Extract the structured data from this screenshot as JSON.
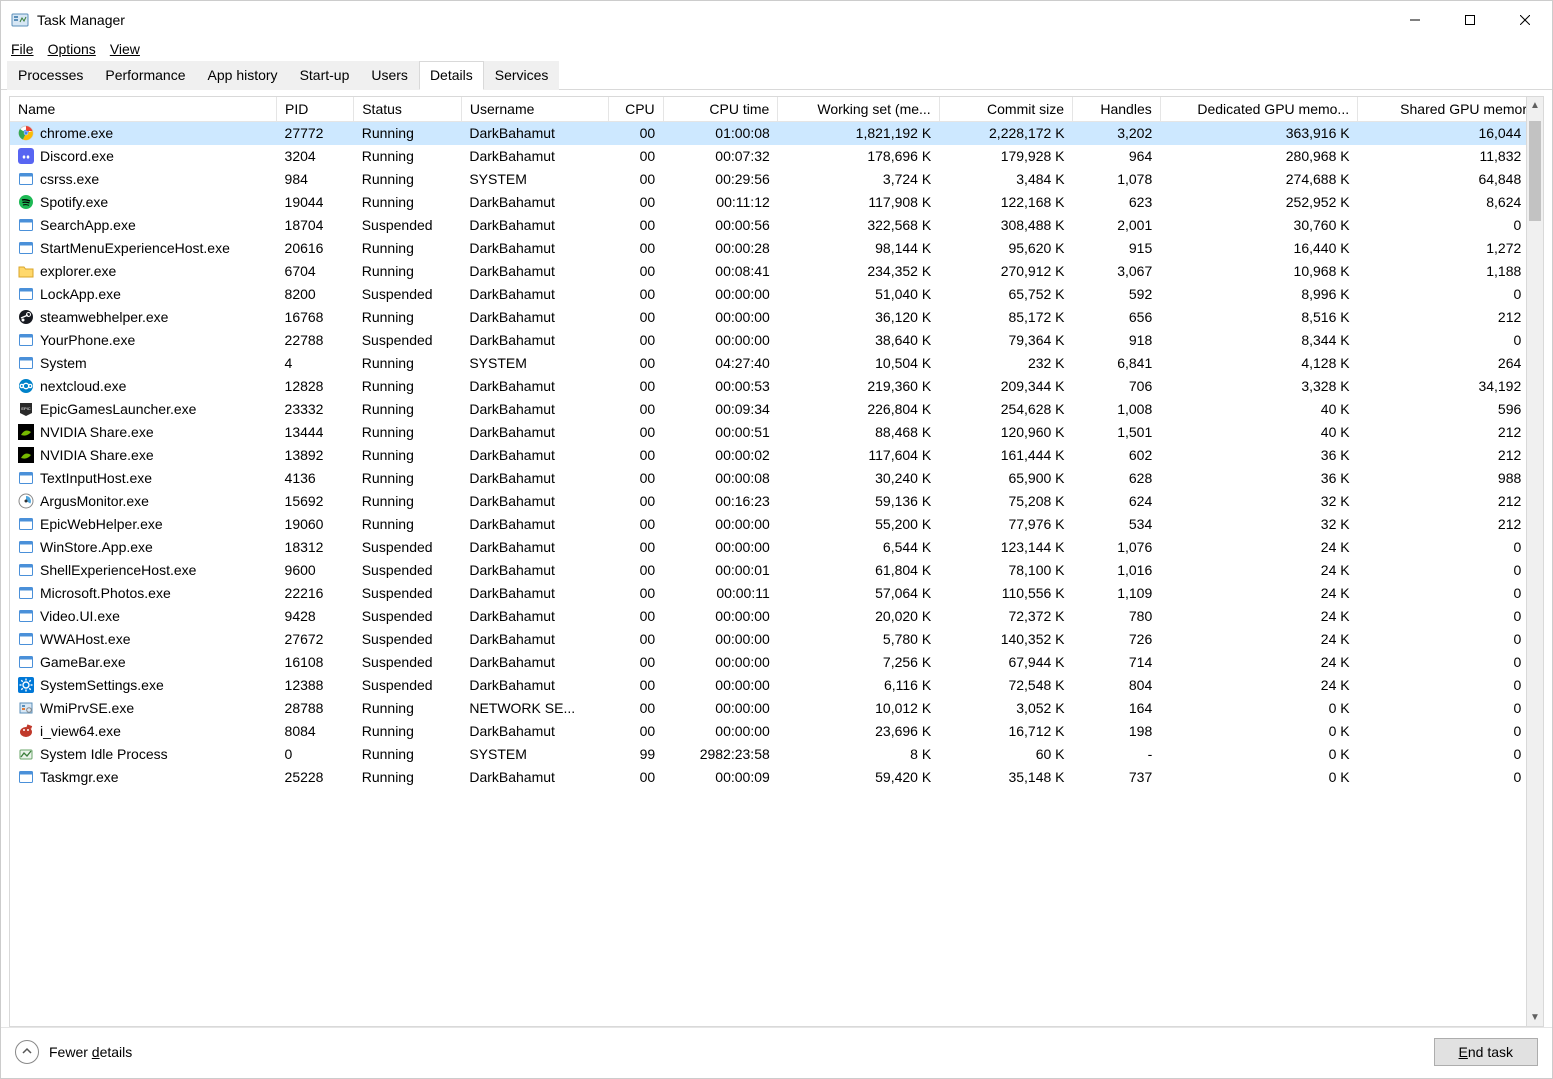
{
  "window": {
    "title": "Task Manager",
    "min_tooltip": "Minimize",
    "max_tooltip": "Maximize",
    "close_tooltip": "Close"
  },
  "menubar": {
    "file": "File",
    "options": "Options",
    "view": "View"
  },
  "tabs": [
    {
      "label": "Processes"
    },
    {
      "label": "Performance"
    },
    {
      "label": "App history"
    },
    {
      "label": "Start-up"
    },
    {
      "label": "Users"
    },
    {
      "label": "Details",
      "active": true
    },
    {
      "label": "Services"
    }
  ],
  "columns": {
    "name": "Name",
    "pid": "PID",
    "status": "Status",
    "username": "Username",
    "cpu": "CPU",
    "cputime": "CPU time",
    "workingset": "Working set (me...",
    "commit": "Commit size",
    "handles": "Handles",
    "dgpu": "Dedicated GPU memo...",
    "sgpu": "Shared GPU memory"
  },
  "processes": [
    {
      "icon": "chrome",
      "name": "chrome.exe",
      "pid": "27772",
      "status": "Running",
      "user": "DarkBahamut",
      "cpu": "00",
      "cputime": "01:00:08",
      "ws": "1,821,192 K",
      "commit": "2,228,172 K",
      "handles": "3,202",
      "dgpu": "363,916 K",
      "sgpu": "16,044 K",
      "selected": true
    },
    {
      "icon": "discord",
      "name": "Discord.exe",
      "pid": "3204",
      "status": "Running",
      "user": "DarkBahamut",
      "cpu": "00",
      "cputime": "00:07:32",
      "ws": "178,696 K",
      "commit": "179,928 K",
      "handles": "964",
      "dgpu": "280,968 K",
      "sgpu": "11,832 K"
    },
    {
      "icon": "winapp",
      "name": "csrss.exe",
      "pid": "984",
      "status": "Running",
      "user": "SYSTEM",
      "cpu": "00",
      "cputime": "00:29:56",
      "ws": "3,724 K",
      "commit": "3,484 K",
      "handles": "1,078",
      "dgpu": "274,688 K",
      "sgpu": "64,848 K"
    },
    {
      "icon": "spotify",
      "name": "Spotify.exe",
      "pid": "19044",
      "status": "Running",
      "user": "DarkBahamut",
      "cpu": "00",
      "cputime": "00:11:12",
      "ws": "117,908 K",
      "commit": "122,168 K",
      "handles": "623",
      "dgpu": "252,952 K",
      "sgpu": "8,624 K"
    },
    {
      "icon": "winapp",
      "name": "SearchApp.exe",
      "pid": "18704",
      "status": "Suspended",
      "user": "DarkBahamut",
      "cpu": "00",
      "cputime": "00:00:56",
      "ws": "322,568 K",
      "commit": "308,488 K",
      "handles": "2,001",
      "dgpu": "30,760 K",
      "sgpu": "0 K"
    },
    {
      "icon": "winapp",
      "name": "StartMenuExperienceHost.exe",
      "pid": "20616",
      "status": "Running",
      "user": "DarkBahamut",
      "cpu": "00",
      "cputime": "00:00:28",
      "ws": "98,144 K",
      "commit": "95,620 K",
      "handles": "915",
      "dgpu": "16,440 K",
      "sgpu": "1,272 K"
    },
    {
      "icon": "explorer",
      "name": "explorer.exe",
      "pid": "6704",
      "status": "Running",
      "user": "DarkBahamut",
      "cpu": "00",
      "cputime": "00:08:41",
      "ws": "234,352 K",
      "commit": "270,912 K",
      "handles": "3,067",
      "dgpu": "10,968 K",
      "sgpu": "1,188 K"
    },
    {
      "icon": "winapp",
      "name": "LockApp.exe",
      "pid": "8200",
      "status": "Suspended",
      "user": "DarkBahamut",
      "cpu": "00",
      "cputime": "00:00:00",
      "ws": "51,040 K",
      "commit": "65,752 K",
      "handles": "592",
      "dgpu": "8,996 K",
      "sgpu": "0 K"
    },
    {
      "icon": "steam",
      "name": "steamwebhelper.exe",
      "pid": "16768",
      "status": "Running",
      "user": "DarkBahamut",
      "cpu": "00",
      "cputime": "00:00:00",
      "ws": "36,120 K",
      "commit": "85,172 K",
      "handles": "656",
      "dgpu": "8,516 K",
      "sgpu": "212 K"
    },
    {
      "icon": "winapp",
      "name": "YourPhone.exe",
      "pid": "22788",
      "status": "Suspended",
      "user": "DarkBahamut",
      "cpu": "00",
      "cputime": "00:00:00",
      "ws": "38,640 K",
      "commit": "79,364 K",
      "handles": "918",
      "dgpu": "8,344 K",
      "sgpu": "0 K"
    },
    {
      "icon": "winapp",
      "name": "System",
      "pid": "4",
      "status": "Running",
      "user": "SYSTEM",
      "cpu": "00",
      "cputime": "04:27:40",
      "ws": "10,504 K",
      "commit": "232 K",
      "handles": "6,841",
      "dgpu": "4,128 K",
      "sgpu": "264 K"
    },
    {
      "icon": "nextcloud",
      "name": "nextcloud.exe",
      "pid": "12828",
      "status": "Running",
      "user": "DarkBahamut",
      "cpu": "00",
      "cputime": "00:00:53",
      "ws": "219,360 K",
      "commit": "209,344 K",
      "handles": "706",
      "dgpu": "3,328 K",
      "sgpu": "34,192 K"
    },
    {
      "icon": "epic",
      "name": "EpicGamesLauncher.exe",
      "pid": "23332",
      "status": "Running",
      "user": "DarkBahamut",
      "cpu": "00",
      "cputime": "00:09:34",
      "ws": "226,804 K",
      "commit": "254,628 K",
      "handles": "1,008",
      "dgpu": "40 K",
      "sgpu": "596 K"
    },
    {
      "icon": "nvidia",
      "name": "NVIDIA Share.exe",
      "pid": "13444",
      "status": "Running",
      "user": "DarkBahamut",
      "cpu": "00",
      "cputime": "00:00:51",
      "ws": "88,468 K",
      "commit": "120,960 K",
      "handles": "1,501",
      "dgpu": "40 K",
      "sgpu": "212 K"
    },
    {
      "icon": "nvidia",
      "name": "NVIDIA Share.exe",
      "pid": "13892",
      "status": "Running",
      "user": "DarkBahamut",
      "cpu": "00",
      "cputime": "00:00:02",
      "ws": "117,604 K",
      "commit": "161,444 K",
      "handles": "602",
      "dgpu": "36 K",
      "sgpu": "212 K"
    },
    {
      "icon": "winapp",
      "name": "TextInputHost.exe",
      "pid": "4136",
      "status": "Running",
      "user": "DarkBahamut",
      "cpu": "00",
      "cputime": "00:00:08",
      "ws": "30,240 K",
      "commit": "65,900 K",
      "handles": "628",
      "dgpu": "36 K",
      "sgpu": "988 K"
    },
    {
      "icon": "argus",
      "name": "ArgusMonitor.exe",
      "pid": "15692",
      "status": "Running",
      "user": "DarkBahamut",
      "cpu": "00",
      "cputime": "00:16:23",
      "ws": "59,136 K",
      "commit": "75,208 K",
      "handles": "624",
      "dgpu": "32 K",
      "sgpu": "212 K"
    },
    {
      "icon": "winapp",
      "name": "EpicWebHelper.exe",
      "pid": "19060",
      "status": "Running",
      "user": "DarkBahamut",
      "cpu": "00",
      "cputime": "00:00:00",
      "ws": "55,200 K",
      "commit": "77,976 K",
      "handles": "534",
      "dgpu": "32 K",
      "sgpu": "212 K"
    },
    {
      "icon": "winapp",
      "name": "WinStore.App.exe",
      "pid": "18312",
      "status": "Suspended",
      "user": "DarkBahamut",
      "cpu": "00",
      "cputime": "00:00:00",
      "ws": "6,544 K",
      "commit": "123,144 K",
      "handles": "1,076",
      "dgpu": "24 K",
      "sgpu": "0 K"
    },
    {
      "icon": "winapp",
      "name": "ShellExperienceHost.exe",
      "pid": "9600",
      "status": "Suspended",
      "user": "DarkBahamut",
      "cpu": "00",
      "cputime": "00:00:01",
      "ws": "61,804 K",
      "commit": "78,100 K",
      "handles": "1,016",
      "dgpu": "24 K",
      "sgpu": "0 K"
    },
    {
      "icon": "winapp",
      "name": "Microsoft.Photos.exe",
      "pid": "22216",
      "status": "Suspended",
      "user": "DarkBahamut",
      "cpu": "00",
      "cputime": "00:00:11",
      "ws": "57,064 K",
      "commit": "110,556 K",
      "handles": "1,109",
      "dgpu": "24 K",
      "sgpu": "0 K"
    },
    {
      "icon": "winapp",
      "name": "Video.UI.exe",
      "pid": "9428",
      "status": "Suspended",
      "user": "DarkBahamut",
      "cpu": "00",
      "cputime": "00:00:00",
      "ws": "20,020 K",
      "commit": "72,372 K",
      "handles": "780",
      "dgpu": "24 K",
      "sgpu": "0 K"
    },
    {
      "icon": "winapp",
      "name": "WWAHost.exe",
      "pid": "27672",
      "status": "Suspended",
      "user": "DarkBahamut",
      "cpu": "00",
      "cputime": "00:00:00",
      "ws": "5,780 K",
      "commit": "140,352 K",
      "handles": "726",
      "dgpu": "24 K",
      "sgpu": "0 K"
    },
    {
      "icon": "winapp",
      "name": "GameBar.exe",
      "pid": "16108",
      "status": "Suspended",
      "user": "DarkBahamut",
      "cpu": "00",
      "cputime": "00:00:00",
      "ws": "7,256 K",
      "commit": "67,944 K",
      "handles": "714",
      "dgpu": "24 K",
      "sgpu": "0 K"
    },
    {
      "icon": "settings",
      "name": "SystemSettings.exe",
      "pid": "12388",
      "status": "Suspended",
      "user": "DarkBahamut",
      "cpu": "00",
      "cputime": "00:00:00",
      "ws": "6,116 K",
      "commit": "72,548 K",
      "handles": "804",
      "dgpu": "24 K",
      "sgpu": "0 K"
    },
    {
      "icon": "wmi",
      "name": "WmiPrvSE.exe",
      "pid": "28788",
      "status": "Running",
      "user": "NETWORK SE...",
      "cpu": "00",
      "cputime": "00:00:00",
      "ws": "10,012 K",
      "commit": "3,052 K",
      "handles": "164",
      "dgpu": "0 K",
      "sgpu": "0 K"
    },
    {
      "icon": "irfan",
      "name": "i_view64.exe",
      "pid": "8084",
      "status": "Running",
      "user": "DarkBahamut",
      "cpu": "00",
      "cputime": "00:00:00",
      "ws": "23,696 K",
      "commit": "16,712 K",
      "handles": "198",
      "dgpu": "0 K",
      "sgpu": "0 K"
    },
    {
      "icon": "idle",
      "name": "System Idle Process",
      "pid": "0",
      "status": "Running",
      "user": "SYSTEM",
      "cpu": "99",
      "cputime": "2982:23:58",
      "ws": "8 K",
      "commit": "60 K",
      "handles": "-",
      "dgpu": "0 K",
      "sgpu": "0 K"
    },
    {
      "icon": "winapp",
      "name": "Taskmgr.exe",
      "pid": "25228",
      "status": "Running",
      "user": "DarkBahamut",
      "cpu": "00",
      "cputime": "00:00:09",
      "ws": "59,420 K",
      "commit": "35,148 K",
      "handles": "737",
      "dgpu": "0 K",
      "sgpu": "0 K"
    }
  ],
  "footer": {
    "fewer_details": "Fewer details",
    "end_task": "End task"
  }
}
